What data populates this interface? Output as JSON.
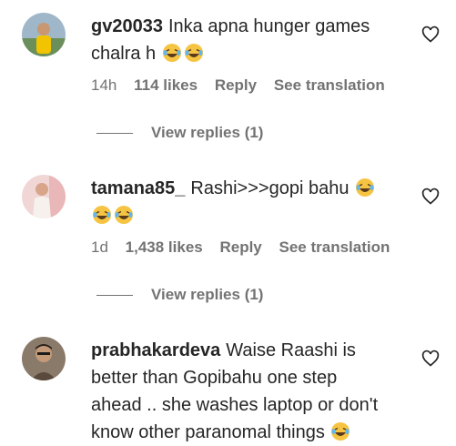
{
  "comments": [
    {
      "username": "gv20033",
      "text": "Inka apna hunger games chalra h",
      "emoji_count": 2,
      "time": "14h",
      "likes": "114 likes",
      "reply": "Reply",
      "see_translation": "See translation",
      "view_replies": "View replies (1)"
    },
    {
      "username": "tamana85_",
      "text": "Rashi>>>gopi bahu",
      "emoji_count": 3,
      "time": "1d",
      "likes": "1,438 likes",
      "reply": "Reply",
      "see_translation": "See translation",
      "view_replies": "View replies (1)"
    },
    {
      "username": "prabhakardeva",
      "text": "Waise Raashi is better than Gopibahu one step ahead .. she washes laptop or don't know other paranomal things",
      "emoji_count": 1
    }
  ],
  "icons": {
    "like": "heart-icon",
    "emoji": "laughing-tears-emoji"
  },
  "colors": {
    "text": "#262626",
    "muted": "#737373",
    "emoji": "#f6c443"
  }
}
